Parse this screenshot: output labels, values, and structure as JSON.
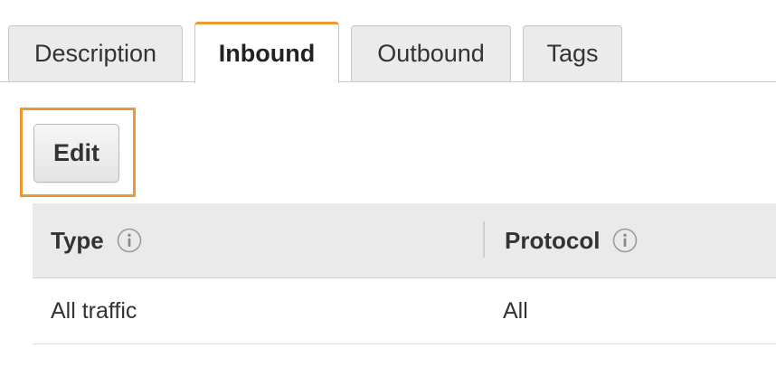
{
  "tabs": [
    {
      "label": "Description",
      "active": false
    },
    {
      "label": "Inbound",
      "active": true
    },
    {
      "label": "Outbound",
      "active": false
    },
    {
      "label": "Tags",
      "active": false
    }
  ],
  "toolbar": {
    "edit_label": "Edit"
  },
  "table": {
    "columns": [
      {
        "label": "Type",
        "icon": "info-icon"
      },
      {
        "label": "Protocol",
        "icon": "info-icon"
      }
    ],
    "rows": [
      [
        "All traffic",
        "All"
      ]
    ]
  },
  "colors": {
    "accent": "#ec9a2f",
    "header_bg": "#eaeaea",
    "tab_bg": "#ebebeb"
  }
}
